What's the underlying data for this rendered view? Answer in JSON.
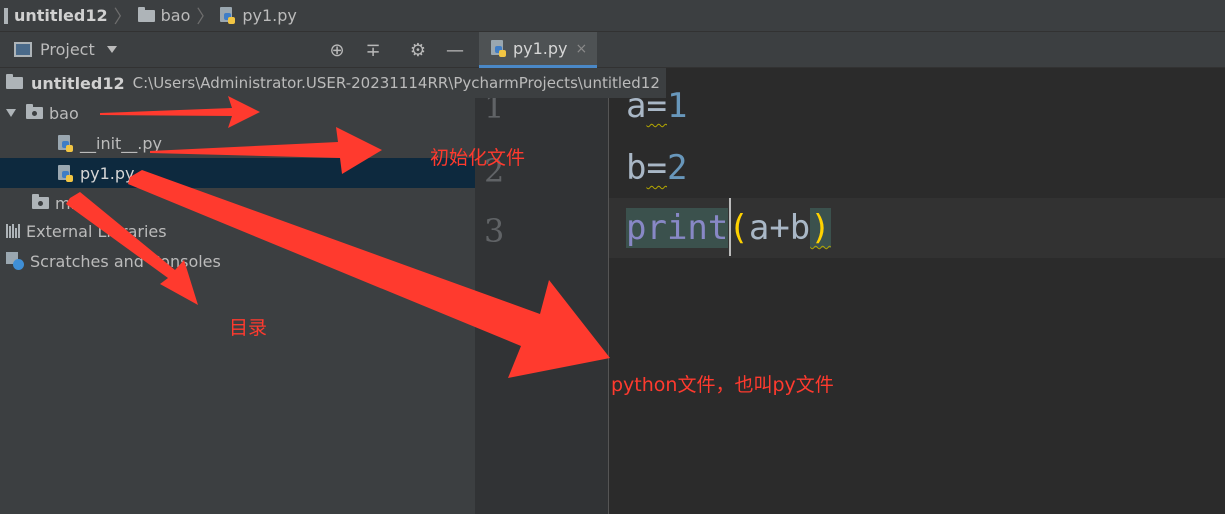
{
  "breadcrumb": [
    "untitled12",
    "bao",
    "py1.py"
  ],
  "project_panel": {
    "view_label": "Project",
    "root": {
      "name": "untitled12",
      "path": "C:\\Users\\Administrator.USER-20231114RR\\PycharmProjects\\untitled12"
    },
    "items": [
      {
        "label": "bao"
      },
      {
        "label": "__init__.py"
      },
      {
        "label": "py1.py"
      },
      {
        "label": "ml"
      },
      {
        "label": "External Libraries"
      },
      {
        "label": "Scratches and Consoles"
      }
    ]
  },
  "editor": {
    "tab_label": "py1.py",
    "tab_close": "×",
    "line_numbers": [
      "1",
      "2",
      "3"
    ],
    "lines": [
      {
        "var": "a",
        "op": "=",
        "val": "1"
      },
      {
        "var": "b",
        "op": "=",
        "val": "2"
      },
      {
        "func": "print",
        "open": "(",
        "expr": "a+b",
        "close": ")"
      }
    ]
  },
  "annotations": {
    "init_file": "初始化文件",
    "directory": "目录",
    "python_file": "python文件，也叫py文件"
  },
  "colors": {
    "annotation": "#ff3a2e",
    "selection": "#0d293e",
    "tab_underline": "#4a88c7"
  }
}
